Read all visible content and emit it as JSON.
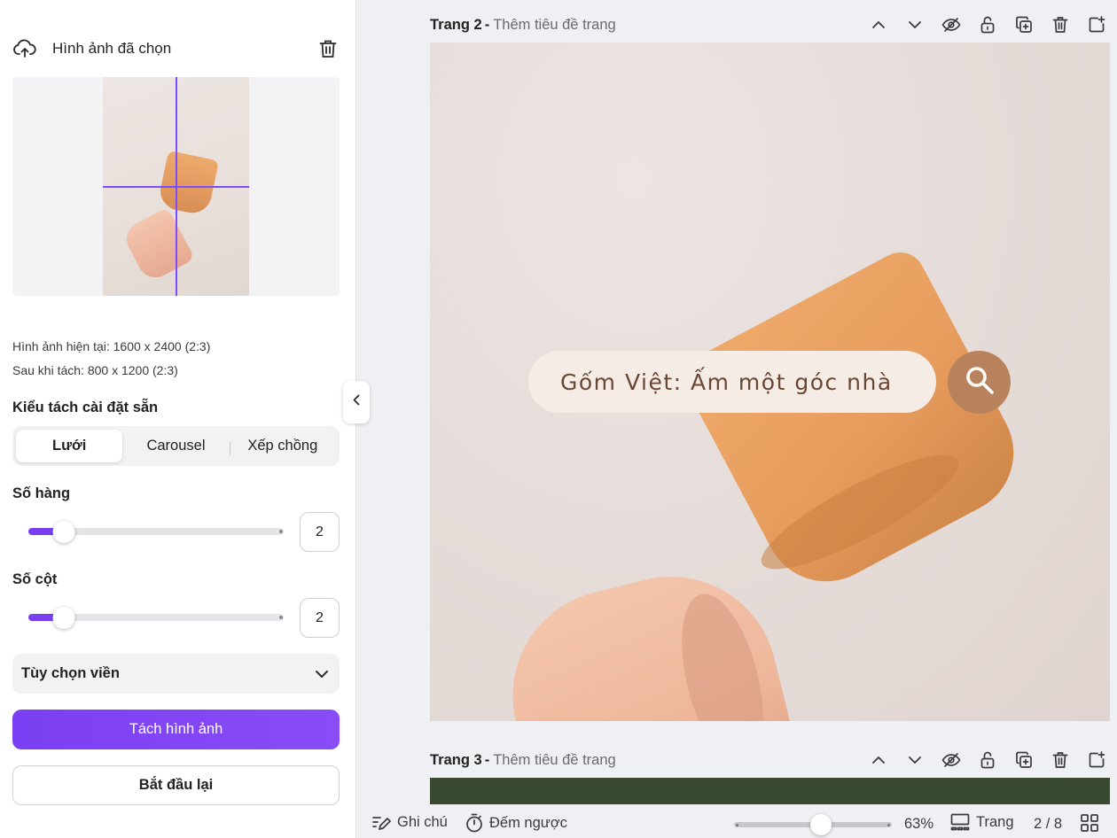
{
  "panel": {
    "title": "Hình ảnh đã chọn",
    "current_image": "Hình ảnh hiện tại: 1600 x 2400 (2:3)",
    "after_split": "Sau khi tách: 800 x 1200 (2:3)",
    "preset_label": "Kiểu tách cài đặt sẵn",
    "presets": [
      "Lưới",
      "Carousel",
      "Xếp chồng"
    ],
    "rows_label": "Số hàng",
    "rows_value": "2",
    "rows_fraction": 0.14,
    "cols_label": "Số cột",
    "cols_value": "2",
    "cols_fraction": 0.14,
    "border_options": "Tùy chọn viền",
    "split_button": "Tách hình ảnh",
    "reset_button": "Bắt đầu lại",
    "accent_color": "#7b3ff3"
  },
  "pages": [
    {
      "name": "Trang 2",
      "separator": "-",
      "title_placeholder": "Thêm tiêu đề trang"
    },
    {
      "name": "Trang 3",
      "separator": "-",
      "title_placeholder": "Thêm tiêu đề trang"
    }
  ],
  "canvas": {
    "search_text": "Gốm Việt: Ấm một góc nhà",
    "search_button_color": "#b8825c"
  },
  "bottombar": {
    "notes": "Ghi chú",
    "timer": "Đếm ngược",
    "zoom": "63%",
    "zoom_fraction": 0.55,
    "pages_label": "Trang",
    "page_count": "2 / 8"
  }
}
